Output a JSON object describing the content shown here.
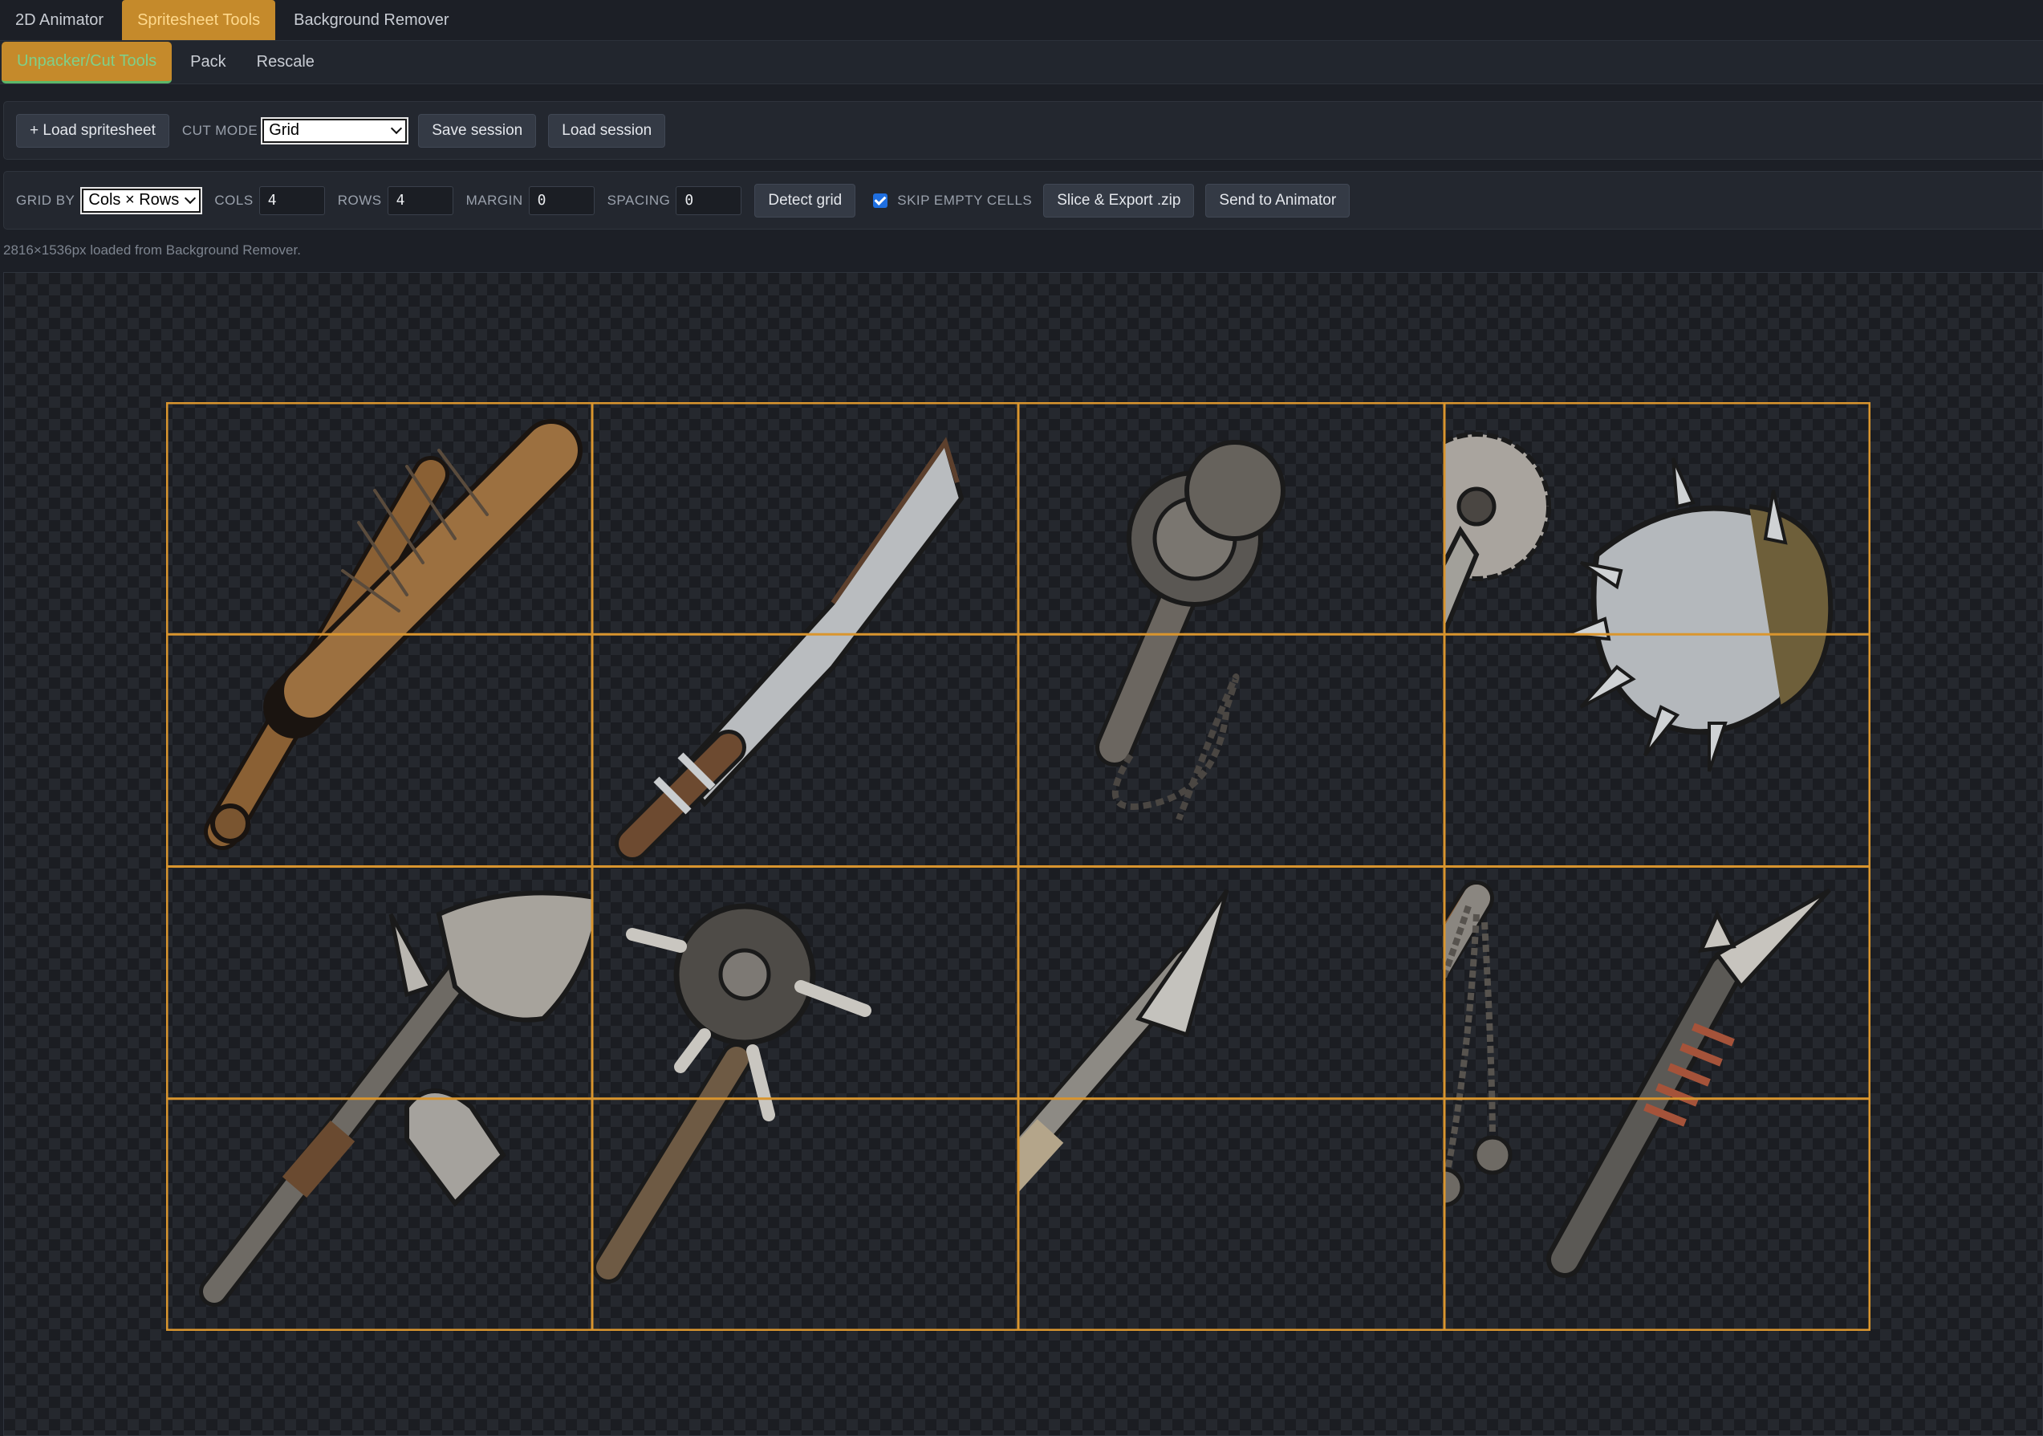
{
  "top_tabs": [
    {
      "label": "2D Animator",
      "active": false
    },
    {
      "label": "Spritesheet Tools",
      "active": true
    },
    {
      "label": "Background Remover",
      "active": false
    }
  ],
  "sub_tabs": [
    {
      "label": "Unpacker/Cut Tools",
      "active": true
    },
    {
      "label": "Pack",
      "active": false
    },
    {
      "label": "Rescale",
      "active": false
    }
  ],
  "toolbar1": {
    "load_button": "+ Load spritesheet",
    "cut_mode_label": "CUT MODE",
    "cut_mode_value": "Grid",
    "save_session": "Save session",
    "load_session": "Load session"
  },
  "toolbar2": {
    "grid_by_label": "GRID BY",
    "grid_by_value": "Cols × Rows",
    "cols_label": "COLS",
    "cols_value": "4",
    "rows_label": "ROWS",
    "rows_value": "4",
    "margin_label": "MARGIN",
    "margin_value": "0",
    "spacing_label": "SPACING",
    "spacing_value": "0",
    "detect_grid": "Detect grid",
    "skip_empty_label": "SKIP EMPTY CELLS",
    "skip_empty_checked": true,
    "slice_export": "Slice & Export .zip",
    "send_animator": "Send to Animator"
  },
  "status": "2816×1536px loaded from Background Remover.",
  "grid": {
    "cols": 4,
    "rows": 4,
    "line_color": "#d9952e"
  },
  "sprites": [
    {
      "name": "nail-bat-icon"
    },
    {
      "name": "serrated-machete-icon"
    },
    {
      "name": "gear-chain-flail-icon"
    },
    {
      "name": "saw-blade-cleaver-icon"
    },
    {
      "name": "spiked-gauntlet-icon"
    },
    {
      "name": "shovel-axe-icon"
    },
    {
      "name": "spark-plug-mace-icon"
    },
    {
      "name": "wrapped-spear-icon"
    },
    {
      "name": "chain-whip-club-icon"
    },
    {
      "name": "spring-spike-mace-icon"
    }
  ]
}
